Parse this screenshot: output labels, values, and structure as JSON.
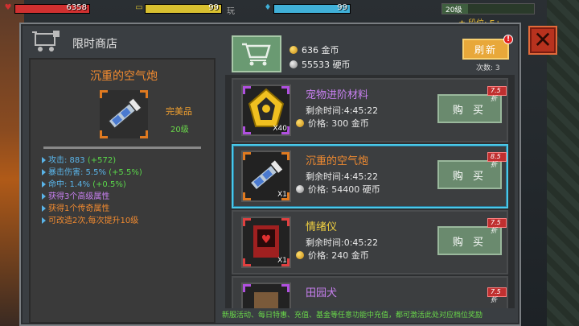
{
  "hud": {
    "hp": {
      "value": "6358",
      "fill_fraction": 1.0,
      "color": "#d03030"
    },
    "energy": {
      "value": "99",
      "fill_fraction": 1.0,
      "color": "#d8c030"
    },
    "energy_extra": "玩",
    "shield": {
      "value": "99",
      "fill_fraction": 1.0,
      "color": "#40b0d8"
    },
    "level": "20级",
    "level_fill_fraction": 0.28,
    "rank": "段位: E+"
  },
  "shop": {
    "title": "限时商店",
    "gold": "636 金币",
    "coins": "55533 硬币",
    "refresh_label": "刷新",
    "refresh_badge": "!",
    "refresh_count": "次数: 3"
  },
  "detail": {
    "name": "沉重的空气炮",
    "quality": "完美品",
    "level": "20级",
    "stats": [
      {
        "text": "攻击: 883 ",
        "bonus": "(+572)",
        "style": "blue"
      },
      {
        "text": "暴击伤害: 5.5% ",
        "bonus": "(+5.5%)",
        "style": "blue"
      },
      {
        "text": "命中: 1.4% ",
        "bonus": "(+0.5%)",
        "style": "blue"
      },
      {
        "text": "获得3个高级属性",
        "bonus": "",
        "style": "purple"
      },
      {
        "text": "获得1个传奇属性",
        "bonus": "",
        "style": "orange"
      },
      {
        "text": "可改造2次,每次提升10级",
        "bonus": "",
        "style": "orange"
      }
    ]
  },
  "items": [
    {
      "name": "宠物进阶材料",
      "name_style": "purple",
      "frame": "purple",
      "qty": "X40",
      "time": "剩余时间:4:45:22",
      "price": "价格: 300 金币",
      "currency": "gold",
      "discount": "7.5折",
      "buy": "购 买",
      "selected": false,
      "icon": "gold-crest-icon"
    },
    {
      "name": "沉重的空气炮",
      "name_style": "orange",
      "frame": "orange",
      "qty": "X1",
      "time": "剩余时间:4:45:22",
      "price": "价格: 54400 硬币",
      "currency": "silver",
      "discount": "8.5折",
      "buy": "购 买",
      "selected": true,
      "icon": "air-cannon-icon"
    },
    {
      "name": "情绪仪",
      "name_style": "yellow",
      "frame": "red",
      "qty": "X1",
      "time": "剩余时间:0:45:22",
      "price": "价格: 240 金币",
      "currency": "gold",
      "discount": "7.5折",
      "buy": "购 买",
      "selected": false,
      "icon": "emotion-device-icon"
    },
    {
      "name": "田园犬",
      "name_style": "purple",
      "frame": "purple",
      "qty": "",
      "time": "",
      "price": "",
      "currency": "gold",
      "discount": "7.5折",
      "buy": "",
      "selected": false,
      "icon": "dog-icon"
    }
  ],
  "ticker": "新服活动、每日特惠、充值、基金等任意功能中充值，都可激活此处对应档位奖励"
}
